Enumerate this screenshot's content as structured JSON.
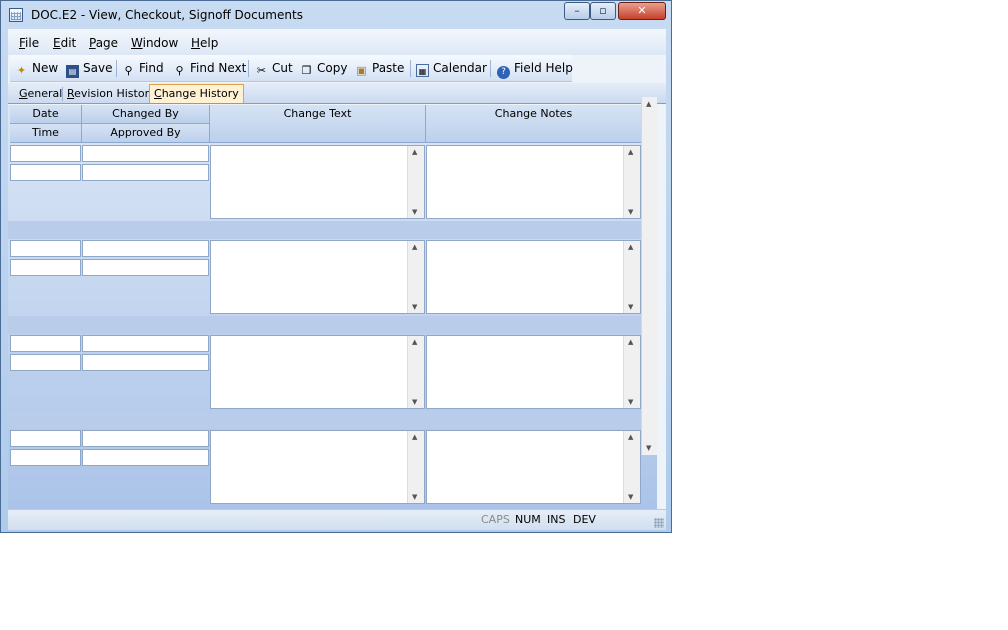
{
  "window": {
    "title": "DOC.E2 - View, Checkout, Signoff Documents"
  },
  "window_controls": {
    "minimize": "–",
    "maximize": "▫",
    "close": "✕"
  },
  "menu": [
    {
      "label": "File",
      "mnemonic": "F",
      "rest": "ile"
    },
    {
      "label": "Edit",
      "mnemonic": "E",
      "rest": "dit"
    },
    {
      "label": "Page",
      "mnemonic": "P",
      "rest": "age"
    },
    {
      "label": "Window",
      "mnemonic": "W",
      "rest": "indow"
    },
    {
      "label": "Help",
      "mnemonic": "H",
      "rest": "elp"
    }
  ],
  "toolbar": {
    "new": "New",
    "save": "Save",
    "find": "Find",
    "find_next": "Find Next",
    "cut": "Cut",
    "copy": "Copy",
    "paste": "Paste",
    "calendar": "Calendar",
    "field_help": "Field Help"
  },
  "tabs": {
    "general": {
      "mnemonic": "G",
      "rest": "eneral"
    },
    "revision_history": {
      "mnemonic": "R",
      "rest": "evision History"
    },
    "change_history": {
      "mnemonic": "C",
      "rest": "hange History"
    }
  },
  "grid": {
    "headers": {
      "date": "Date",
      "time": "Time",
      "changed_by": "Changed By",
      "approved_by": "Approved By",
      "change_text": "Change Text",
      "change_notes": "Change Notes"
    },
    "rows": [
      {
        "date": "",
        "time": "",
        "changed_by": "",
        "approved_by": "",
        "change_text": "",
        "change_notes": ""
      },
      {
        "date": "",
        "time": "",
        "changed_by": "",
        "approved_by": "",
        "change_text": "",
        "change_notes": ""
      },
      {
        "date": "",
        "time": "",
        "changed_by": "",
        "approved_by": "",
        "change_text": "",
        "change_notes": ""
      },
      {
        "date": "",
        "time": "",
        "changed_by": "",
        "approved_by": "",
        "change_text": "",
        "change_notes": ""
      }
    ]
  },
  "status": {
    "caps": "CAPS",
    "num": "NUM",
    "ins": "INS",
    "dev": "DEV"
  }
}
